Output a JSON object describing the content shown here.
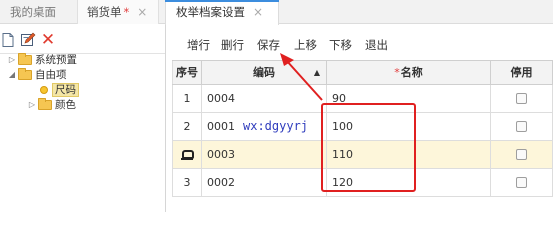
{
  "tabs": [
    {
      "label": "我的桌面",
      "closable": false,
      "modified": false,
      "active": false
    },
    {
      "label": "销货单",
      "closable": true,
      "modified": true,
      "modified_mark": "*",
      "active": false
    },
    {
      "label": "枚举档案设置",
      "closable": true,
      "modified": false,
      "active": true
    }
  ],
  "tab_close_icon": "×",
  "left_toolbar": {
    "icons": [
      "new-document-icon",
      "edit-icon",
      "delete-icon"
    ],
    "delete_glyph": "✕"
  },
  "tree": [
    {
      "label": "系统预置",
      "type": "folder",
      "expanded": false
    },
    {
      "label": "自由项",
      "type": "folder",
      "expanded": true
    },
    {
      "label": "尺码",
      "type": "leaf",
      "selected": true
    },
    {
      "label": "颜色",
      "type": "folder",
      "expanded": false
    }
  ],
  "toolbar": {
    "add_row": "增行",
    "delete_row": "删行",
    "save": "保存",
    "move_up": "上移",
    "move_down": "下移",
    "exit": "退出"
  },
  "table": {
    "headers": {
      "seq": "序号",
      "code": "编码",
      "name": "名称",
      "disabled": "停用"
    },
    "required_mark": "*",
    "sort_indicator": "▲",
    "rows": [
      {
        "seq": "1",
        "code": "0004",
        "name": "90",
        "disabled": false,
        "editing": false
      },
      {
        "seq": "2",
        "code": "0001",
        "name": "100",
        "disabled": false,
        "editing": false
      },
      {
        "seq": "",
        "code": "0003",
        "name": "110",
        "disabled": false,
        "editing": true
      },
      {
        "seq": "3",
        "code": "0002",
        "name": "120",
        "disabled": false,
        "editing": false
      }
    ]
  },
  "watermark_text": "wx:dgyyrj",
  "annotation_color": "#e02020",
  "accent_color": "#3c8dde"
}
